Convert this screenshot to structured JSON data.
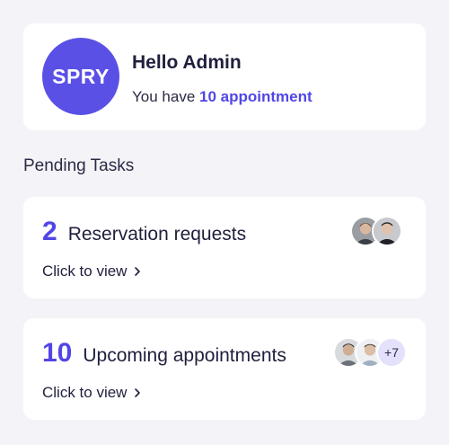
{
  "profile": {
    "logo_text": "SPRY",
    "greeting": "Hello Admin",
    "subline_prefix": "You have",
    "appointment_count_text": "10 appointment"
  },
  "section_title": "Pending Tasks",
  "tasks": [
    {
      "count": "2",
      "label": "Reservation requests",
      "link": "Click to view",
      "avatars": [
        "avatar",
        "avatar"
      ]
    },
    {
      "count": "10",
      "label": "Upcoming appointments",
      "link": "Click to view",
      "avatars": [
        "avatar",
        "avatar"
      ],
      "more": "+7"
    }
  ],
  "colors": {
    "accent": "#5146e5",
    "logo_bg": "#5a50e6",
    "background": "#f4f4f8",
    "more_badge": "#e3e1fb"
  }
}
